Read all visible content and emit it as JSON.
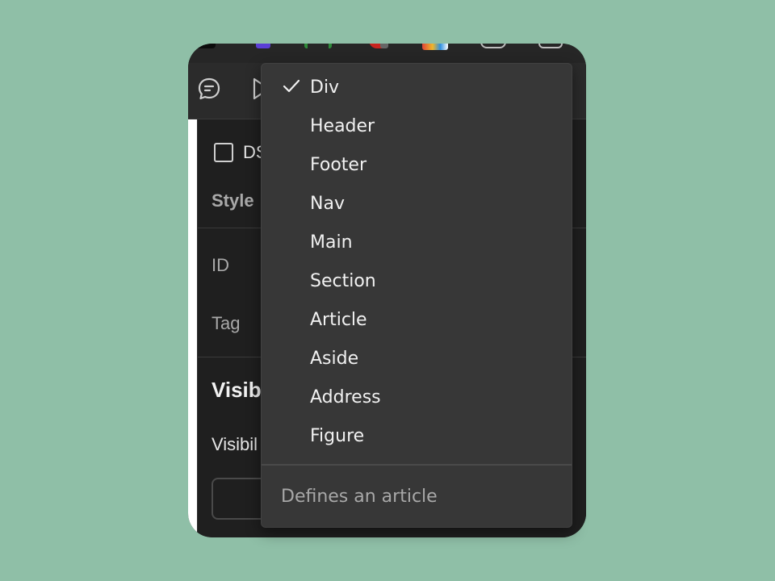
{
  "panel": {
    "checkbox_label": "DS",
    "style_heading": "Style",
    "id_label": "ID",
    "tag_label": "Tag",
    "visibility_heading": "Visib",
    "visibility_label": "Visibil"
  },
  "dropdown": {
    "selected": "Div",
    "items": [
      {
        "label": "Div"
      },
      {
        "label": "Header"
      },
      {
        "label": "Footer"
      },
      {
        "label": "Nav"
      },
      {
        "label": "Main"
      },
      {
        "label": "Section"
      },
      {
        "label": "Article"
      },
      {
        "label": "Aside"
      },
      {
        "label": "Address"
      },
      {
        "label": "Figure"
      }
    ],
    "description": "Defines an article"
  },
  "icons": {
    "toolbar": [
      "comment-icon",
      "play-icon"
    ],
    "menu": [
      "checkmark-icon"
    ]
  },
  "colors": {
    "background": "#8fbfa7",
    "panel": "#1f1f1f",
    "menu": "#373737"
  }
}
